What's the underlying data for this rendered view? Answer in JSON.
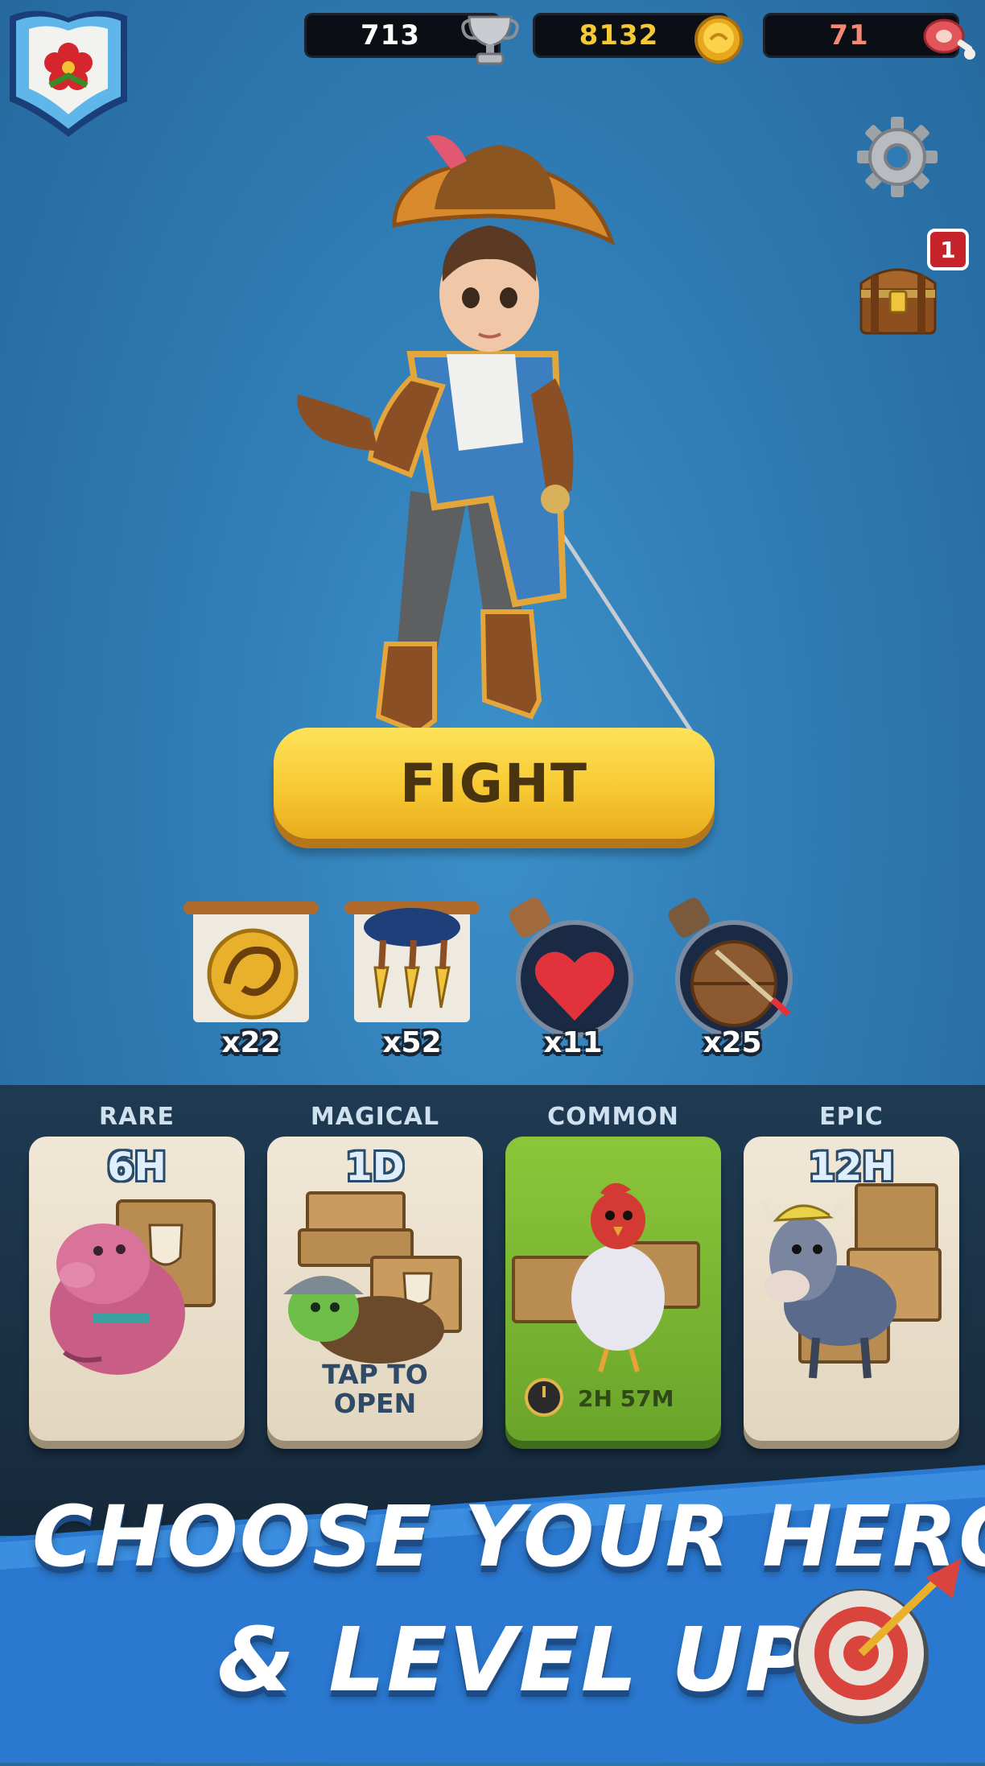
{
  "resources": {
    "trophies": "713",
    "coins": "8132",
    "meat": "71"
  },
  "notifications": {
    "chest_badge": "1"
  },
  "fight_button": "FIGHT",
  "items": [
    {
      "icon": "dragon-coin-scroll-icon",
      "count": "x22"
    },
    {
      "icon": "arrow-rain-scroll-icon",
      "count": "x52"
    },
    {
      "icon": "heart-potion-icon",
      "count": "x11"
    },
    {
      "icon": "shield-potion-icon",
      "count": "x25"
    }
  ],
  "chests": [
    {
      "rarity": "RARE",
      "timer": "6H",
      "action": "",
      "countdown": ""
    },
    {
      "rarity": "MAGICAL",
      "timer": "1D",
      "action": "TAP TO\nOPEN",
      "countdown": ""
    },
    {
      "rarity": "COMMON",
      "timer": "",
      "action": "",
      "countdown": "2H 57M"
    },
    {
      "rarity": "EPIC",
      "timer": "12H",
      "action": "",
      "countdown": ""
    }
  ],
  "promo": {
    "line1": "CHOOSE YOUR HERO",
    "line2": "& LEVEL UP"
  },
  "colors": {
    "background": "#2f7bb3",
    "fight_button": "#f7c932",
    "common_card": "#7cb634",
    "card": "#ebe1cd"
  }
}
